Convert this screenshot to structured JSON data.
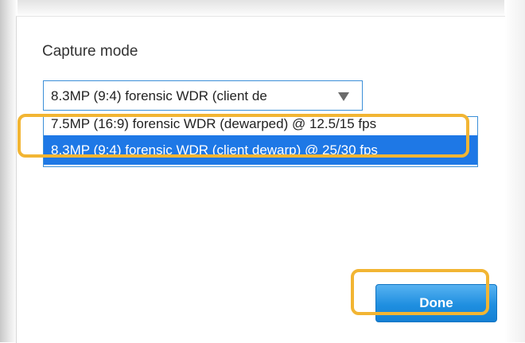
{
  "dialog": {
    "title": "Capture mode",
    "select": {
      "selected_value": "8.3MP (9:4) forensic WDR (client de",
      "options": [
        "7.5MP (16:9) forensic WDR (dewarped) @ 12.5/15 fps",
        "8.3MP (9:4) forensic WDR (client dewarp) @ 25/30 fps"
      ]
    },
    "done_label": "Done"
  },
  "colors": {
    "accent": "#1e78e6",
    "highlight": "#f2b533",
    "button": "#1f8fe0"
  },
  "icons": {
    "dropdown_arrow": "chevron-down-icon"
  }
}
